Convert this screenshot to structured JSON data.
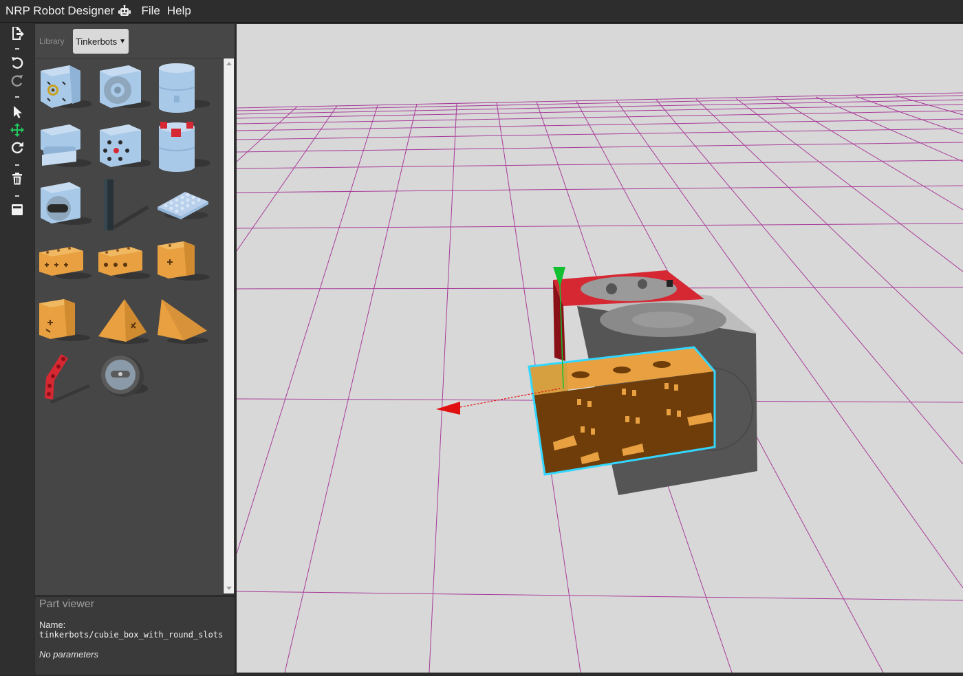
{
  "app": {
    "title": "NRP Robot Designer",
    "menu": [
      {
        "label": "File"
      },
      {
        "label": "Help"
      }
    ]
  },
  "toolbar": {
    "tools": [
      {
        "icon": "export-icon"
      },
      {
        "icon": "undo-icon"
      },
      {
        "icon": "redo-icon"
      },
      {
        "icon": "pointer-icon"
      },
      {
        "icon": "move-icon",
        "active": true
      },
      {
        "icon": "rotate-icon"
      },
      {
        "icon": "trash-icon"
      },
      {
        "icon": "save-icon"
      }
    ]
  },
  "library": {
    "label": "Library",
    "selected": "Tinkerbots",
    "parts": [
      {
        "icon": "blue-cube-spiral-icon"
      },
      {
        "icon": "blue-cube-wheel-icon"
      },
      {
        "icon": "blue-cylinder-icon"
      },
      {
        "icon": "blue-hinge-icon"
      },
      {
        "icon": "blue-cube-dots-icon"
      },
      {
        "icon": "blue-cylinder-red-icon"
      },
      {
        "icon": "blue-cube-slot-icon"
      },
      {
        "icon": "black-rod-icon"
      },
      {
        "icon": "blue-plate-icon"
      },
      {
        "icon": "orange-box-cross-icon"
      },
      {
        "icon": "orange-box-round-slots-icon"
      },
      {
        "icon": "orange-cube-icon"
      },
      {
        "icon": "orange-cube-corner-icon"
      },
      {
        "icon": "orange-pyramid-icon"
      },
      {
        "icon": "orange-wedge-icon"
      },
      {
        "icon": "red-beam-icon"
      },
      {
        "icon": "grey-wheel-icon"
      }
    ]
  },
  "part_viewer": {
    "title": "Part viewer",
    "name_label": "Name:",
    "name_value": "tinkerbots/cubie_box_with_round_slots",
    "params": "No parameters"
  },
  "colors": {
    "grid": "#a0208f",
    "selection": "#33d6ff",
    "axis_x": "#e01010",
    "axis_y": "#10c030",
    "part_orange": "#e8a040",
    "part_blue": "#a9c9e8",
    "part_red": "#d62833"
  }
}
